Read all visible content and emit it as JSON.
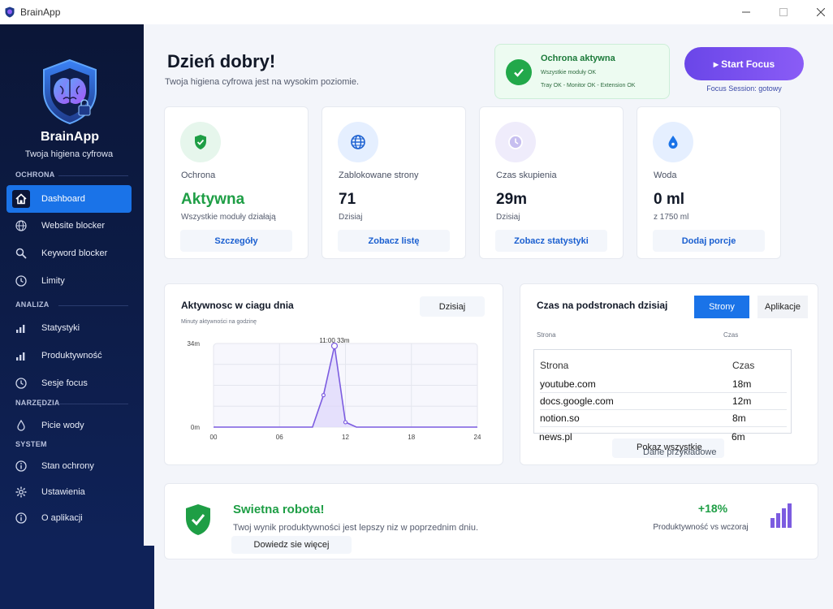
{
  "window": {
    "title": "BrainApp"
  },
  "sidebar": {
    "brand": "BrainApp",
    "tagline": "Twoja higiena cyfrowa",
    "sections": [
      "OCHRONA",
      "ANALIZA",
      "NARZĘDZIA",
      "SYSTEM"
    ],
    "items": [
      {
        "label": "Dashboard",
        "icon": "home-icon",
        "active": true
      },
      {
        "label": "Website blocker",
        "icon": "globe-icon"
      },
      {
        "label": "Keyword blocker",
        "icon": "search-icon"
      },
      {
        "label": "Limity",
        "icon": "clock-icon"
      },
      {
        "label": "Statystyki",
        "icon": "bar-chart-icon"
      },
      {
        "label": "Produktywność",
        "icon": "bar-chart-icon"
      },
      {
        "label": "Sesje focus",
        "icon": "clock-icon"
      },
      {
        "label": "Picie wody",
        "icon": "water-drop-icon"
      },
      {
        "label": "Stan ochrony",
        "icon": "info-icon"
      },
      {
        "label": "Ustawienia",
        "icon": "gear-icon"
      },
      {
        "label": "O aplikacji",
        "icon": "info-icon"
      }
    ]
  },
  "header": {
    "greeting": "Dzień dobry!",
    "subtitle": "Twoja higiena cyfrowa jest na wysokim poziomie."
  },
  "protection": {
    "title": "Ochrona aktywna",
    "line1": "Wszystkie moduły OK",
    "line2": "Tray OK - Monitor OK - Extension OK"
  },
  "focus": {
    "button_label": "▸ Start Focus",
    "status": "Focus Session: gotowy"
  },
  "cards": [
    {
      "label": "Ochrona",
      "value": "Aktywna",
      "sub": "Wszystkie moduły działają",
      "button": "Szczegóły",
      "icon": "shield-check-icon",
      "color": "#1e9e45"
    },
    {
      "label": "Zablokowane strony",
      "value": "71",
      "sub": "Dzisiaj",
      "button": "Zobacz listę",
      "icon": "globe-icon",
      "color": "#1a5fd0"
    },
    {
      "label": "Czas skupienia",
      "value": "29m",
      "sub": "Dzisiaj",
      "button": "Zobacz statystyki",
      "icon": "clock-icon",
      "color": "#8b7be0"
    },
    {
      "label": "Woda",
      "value": "0 ml",
      "sub": "z 1750 ml",
      "button": "Dodaj porcje",
      "icon": "water-drop-icon",
      "color": "#1a73e8"
    }
  ],
  "activity": {
    "title": "Aktywnosc w ciagu dnia",
    "subtitle": "Minuty aktywności na godzinę",
    "button": "Dzisiaj",
    "peak_label": "11:00  33m"
  },
  "chart_data": {
    "type": "area",
    "title": "Aktywnosc w ciagu dnia",
    "ylabel": "Minuty aktywności na godzinę",
    "x": [
      0,
      1,
      2,
      3,
      4,
      5,
      6,
      7,
      8,
      9,
      10,
      11,
      12,
      13,
      14,
      15,
      16,
      17,
      18,
      19,
      20,
      21,
      22,
      23,
      24
    ],
    "values": [
      0,
      0,
      0,
      0,
      0,
      0,
      0,
      0,
      0,
      0,
      13,
      33,
      2,
      0,
      0,
      0,
      0,
      0,
      0,
      0,
      0,
      0,
      0,
      0,
      0
    ],
    "xticks": [
      "00",
      "06",
      "12",
      "18",
      "24"
    ],
    "yticks": [
      "0m",
      "34m"
    ],
    "ylim": [
      0,
      34
    ],
    "xlim": [
      0,
      24
    ],
    "grid": true,
    "color": "#7c5ce0"
  },
  "pages": {
    "title": "Czas na podstronach dzisiaj",
    "tab_active": "Strony",
    "tab_inactive": "Aplikacje",
    "col_site_small": "Strona",
    "col_time_small": "Czas",
    "col_site": "Strona",
    "col_time": "Czas",
    "rows": [
      {
        "site": "youtube.com",
        "time": "18m"
      },
      {
        "site": "docs.google.com",
        "time": "12m"
      },
      {
        "site": "notion.so",
        "time": "8m"
      }
    ],
    "tail": {
      "site": "news.pl",
      "time": "6m"
    },
    "show_all": "Pokaz wszystkie",
    "sample_note": "Dane przykładowe"
  },
  "summary": {
    "title": "Swietna robota!",
    "desc": "Twoj wynik produktywności jest lepszy niz w poprzednim dniu.",
    "button": "Dowiedz sie więcej",
    "percent": "+18%",
    "percent_label": "Produktywność vs wczoraj"
  }
}
